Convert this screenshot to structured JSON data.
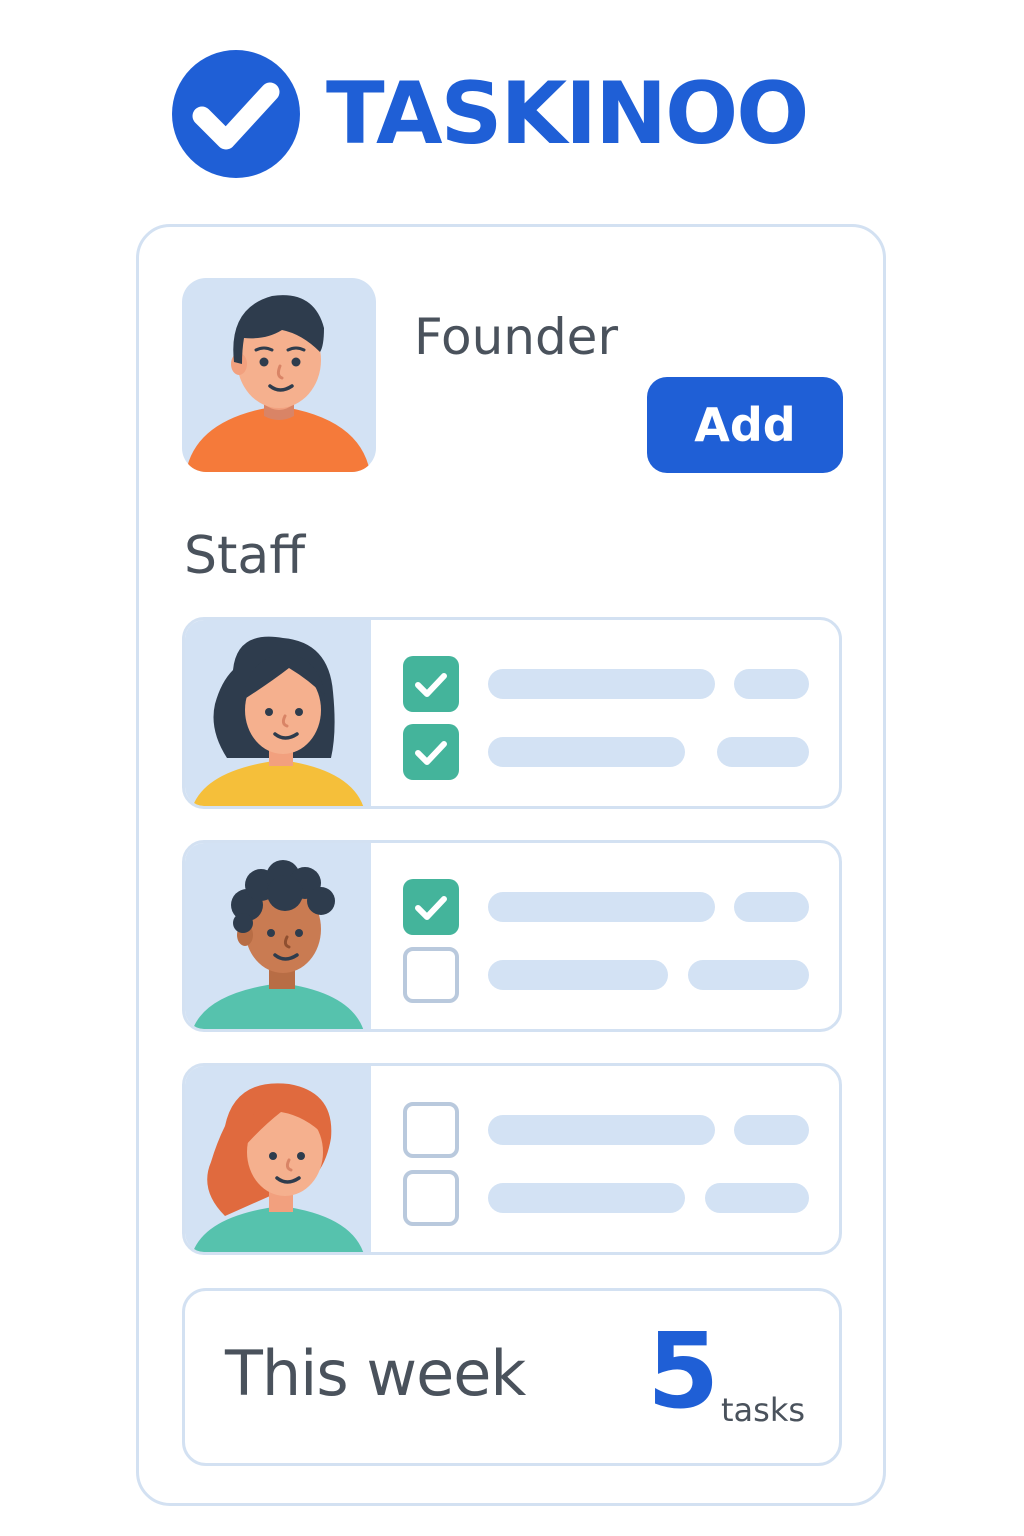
{
  "app": {
    "brand": "TASKINOO",
    "logo_icon": "checkmark-circle-icon",
    "accent_color": "#1f5fd6",
    "check_color": "#44b49b"
  },
  "founder": {
    "label": "Founder",
    "avatar": "founder-avatar",
    "add_label": "Add"
  },
  "staff": {
    "label": "Staff",
    "members": [
      {
        "avatar": "staff-avatar-woman-dark-hair",
        "tasks": [
          {
            "checked": true
          },
          {
            "checked": true
          }
        ]
      },
      {
        "avatar": "staff-avatar-man-curly-hair",
        "tasks": [
          {
            "checked": true
          },
          {
            "checked": false
          }
        ]
      },
      {
        "avatar": "staff-avatar-woman-red-hair",
        "tasks": [
          {
            "checked": false
          },
          {
            "checked": false
          }
        ]
      }
    ]
  },
  "summary": {
    "label": "This week",
    "count": "5",
    "unit": "tasks"
  }
}
